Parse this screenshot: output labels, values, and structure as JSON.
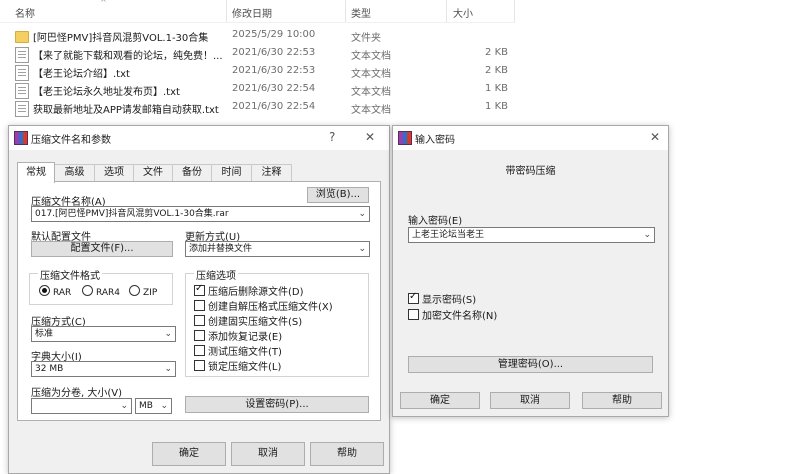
{
  "explorer": {
    "columns": {
      "name": "名称",
      "date": "修改日期",
      "type": "类型",
      "size": "大小"
    },
    "files": [
      {
        "name": "[阿巴怪PMV]抖音风混剪VOL.1-30合集",
        "date": "2025/5/29 10:00",
        "type": "文件夹",
        "size": "",
        "icon": "folder-icon"
      },
      {
        "name": "【来了就能下载和观看的论坛，纯免费！...",
        "date": "2021/6/30 22:53",
        "type": "文本文档",
        "size": "2 KB",
        "icon": "text-file-icon"
      },
      {
        "name": "【老王论坛介绍】.txt",
        "date": "2021/6/30 22:53",
        "type": "文本文档",
        "size": "2 KB",
        "icon": "text-file-icon"
      },
      {
        "name": "【老王论坛永久地址发布页】.txt",
        "date": "2021/6/30 22:54",
        "type": "文本文档",
        "size": "1 KB",
        "icon": "text-file-icon"
      },
      {
        "name": "获取最新地址及APP请发邮箱自动获取.txt",
        "date": "2021/6/30 22:54",
        "type": "文本文档",
        "size": "1 KB",
        "icon": "text-file-icon"
      }
    ]
  },
  "archive_dialog": {
    "title": "压缩文件名和参数",
    "help": "?",
    "close": "✕",
    "tabs": [
      "常规",
      "高级",
      "选项",
      "文件",
      "备份",
      "时间",
      "注释"
    ],
    "archive_name_label": "压缩文件名称(A)",
    "browse": "浏览(B)...",
    "archive_name_value": "017.[阿巴怪PMV]抖音风混剪VOL.1-30合集.rar",
    "default_profile_label": "默认配置文件",
    "profiles_button": "配置文件(F)...",
    "update_mode_label": "更新方式(U)",
    "update_mode_value": "添加并替换文件",
    "format_label": "压缩文件格式",
    "formats": [
      "RAR",
      "RAR4",
      "ZIP"
    ],
    "method_label": "压缩方式(C)",
    "method_value": "标准",
    "dict_label": "字典大小(I)",
    "dict_value": "32 MB",
    "split_label": "压缩为分卷, 大小(V)",
    "split_unit": "MB",
    "options_label": "压缩选项",
    "options": [
      {
        "label": "压缩后删除源文件(D)",
        "checked": true
      },
      {
        "label": "创建自解压格式压缩文件(X)",
        "checked": false
      },
      {
        "label": "创建固实压缩文件(S)",
        "checked": false
      },
      {
        "label": "添加恢复记录(E)",
        "checked": false
      },
      {
        "label": "测试压缩文件(T)",
        "checked": false
      },
      {
        "label": "锁定压缩文件(L)",
        "checked": false
      }
    ],
    "set_password": "设置密码(P)...",
    "ok": "确定",
    "cancel": "取消",
    "help_button": "帮助"
  },
  "password_dialog": {
    "title": "输入密码",
    "close": "✕",
    "heading": "带密码压缩",
    "password_label": "输入密码(E)",
    "password_value": "上老王论坛当老王",
    "show_password": "显示密码(S)",
    "encrypt_names": "加密文件名称(N)",
    "manage": "管理密码(O)...",
    "ok": "确定",
    "cancel": "取消",
    "help_button": "帮助"
  }
}
